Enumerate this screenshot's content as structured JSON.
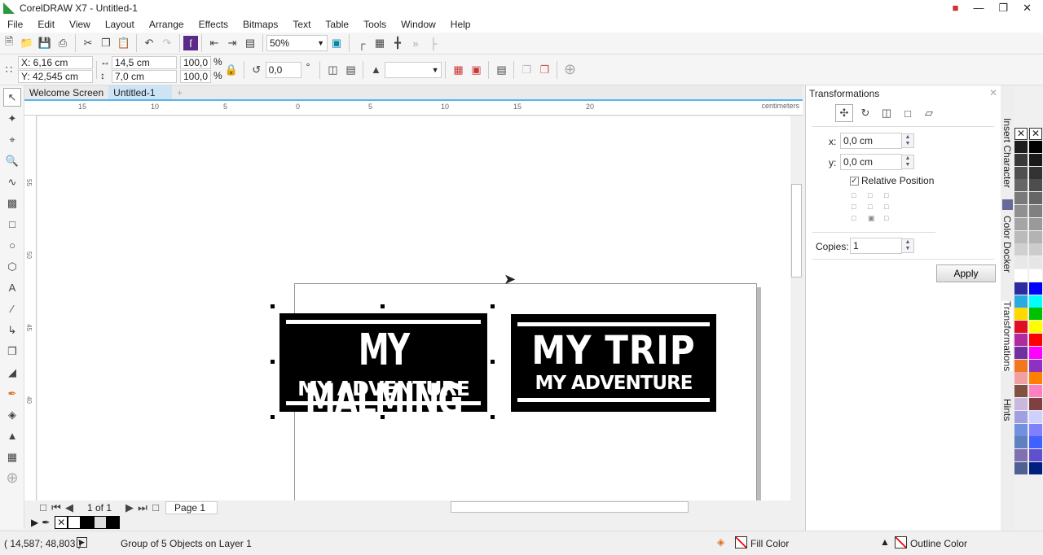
{
  "window": {
    "title": "CorelDRAW X7 - Untitled-1"
  },
  "menu": [
    "File",
    "Edit",
    "View",
    "Layout",
    "Arrange",
    "Effects",
    "Bitmaps",
    "Text",
    "Table",
    "Tools",
    "Window",
    "Help"
  ],
  "toolbar": {
    "zoom": "50%"
  },
  "propbar": {
    "x": "X: 6,16 cm",
    "y": "Y: 42,545 cm",
    "width": "14,5 cm",
    "height": "7,0 cm",
    "scale_x": "100,0",
    "scale_y": "100,0",
    "pct": "%",
    "rotation": "0,0",
    "deg": "°"
  },
  "tabs": [
    {
      "label": "Welcome Screen"
    },
    {
      "label": "Untitled-1",
      "active": true
    }
  ],
  "ruler": {
    "h_ticks": [
      "15",
      "10",
      "5",
      "0",
      "5",
      "10",
      "15",
      "20"
    ],
    "unit": "centimeters",
    "v_ticks": [
      "55",
      "50",
      "45",
      "40"
    ]
  },
  "artwork": {
    "logo1": {
      "line1": "MY MALMING",
      "line2": "MY ADVENTURE"
    },
    "logo2": {
      "line1": "MY TRIP",
      "line2": "MY ADVENTURE"
    }
  },
  "pagenav": {
    "count": "1 of 1",
    "page": "Page 1"
  },
  "docker": {
    "title": "Transformations",
    "x_label": "x:",
    "x_value": "0,0 cm",
    "y_label": "y:",
    "y_value": "0,0 cm",
    "relative": "Relative Position",
    "relative_checked": true,
    "copies_label": "Copies:",
    "copies": "1",
    "apply": "Apply"
  },
  "sidetabs": [
    "Insert Character",
    "Color Docker",
    "Transformations",
    "Hints"
  ],
  "palette_left": [
    "#1e1e1e",
    "#3a3a3a",
    "#505050",
    "#666",
    "#7a7a7a",
    "#909090",
    "#a5a5a5",
    "#bbb",
    "#d0d0d0",
    "#e8e8e8",
    "#fff",
    "#2c2ca0",
    "#29abe2",
    "#ffd800",
    "#e01020",
    "#b02aa0",
    "#7030a0",
    "#f07820",
    "#f0a0a0",
    "#805040",
    "#c8b8e0",
    "#a0a0e0",
    "#7090e0",
    "#6080c0",
    "#8070b0",
    "#506090"
  ],
  "palette_right": [
    "#000",
    "#1a1a1a",
    "#333",
    "#4d4d4d",
    "#666",
    "#808080",
    "#999",
    "#b3b3b3",
    "#ccc",
    "#e6e6e6",
    "#fff",
    "#0000ff",
    "#00ffff",
    "#00c000",
    "#ffff00",
    "#ff0000",
    "#ff00ff",
    "#9030c0",
    "#ff8000",
    "#ff80c0",
    "#804040",
    "#d0d0ff",
    "#8080ff",
    "#4060ff",
    "#6050d0",
    "#002080"
  ],
  "status": {
    "coords": "( 14,587; 48,803 )",
    "selection": "Group of 5 Objects on Layer 1",
    "fill": "Fill Color",
    "outline": "Outline Color"
  }
}
